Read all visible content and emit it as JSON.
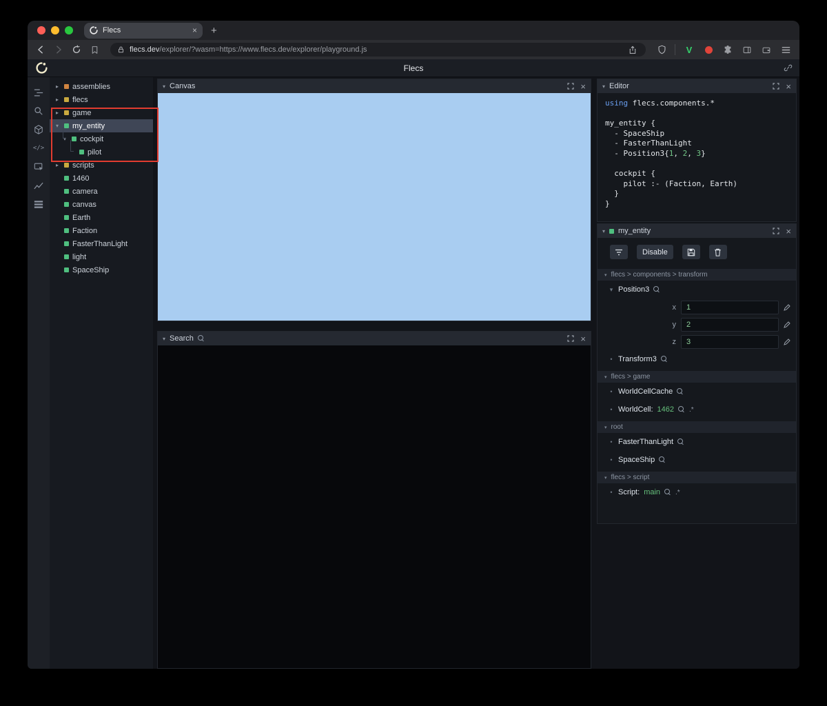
{
  "browser": {
    "tab_title": "Flecs",
    "url_domain": "flecs.dev",
    "url_rest": "/explorer/?wasm=https://www.flecs.dev/explorer/playground.js",
    "extension_v": "V"
  },
  "app": {
    "title": "Flecs",
    "canvas_color": "#a9cdf1",
    "annotation_color": "#e23c30",
    "tree": [
      {
        "label": "assemblies",
        "dot": "#d08440",
        "arrow": "collapsed",
        "indent": 0,
        "selected": false
      },
      {
        "label": "flecs",
        "dot": "#c9a93f",
        "arrow": "collapsed",
        "indent": 0,
        "selected": false
      },
      {
        "label": "game",
        "dot": "#c9a93f",
        "arrow": "collapsed",
        "indent": 0,
        "selected": false
      },
      {
        "label": "my_entity",
        "dot": "#4fbf7f",
        "arrow": "expanded",
        "indent": 0,
        "selected": true
      },
      {
        "label": "cockpit",
        "dot": "#4fbf7f",
        "arrow": "expanded",
        "indent": 1,
        "selected": false
      },
      {
        "label": "pilot",
        "dot": "#4fbf7f",
        "arrow": "none",
        "indent": 2,
        "selected": false
      },
      {
        "label": "scripts",
        "dot": "#c9a93f",
        "arrow": "collapsed",
        "indent": 0,
        "selected": false
      },
      {
        "label": "1460",
        "dot": "#4fbf7f",
        "arrow": "none",
        "indent": 0,
        "selected": false
      },
      {
        "label": "camera",
        "dot": "#4fbf7f",
        "arrow": "none",
        "indent": 0,
        "selected": false
      },
      {
        "label": "canvas",
        "dot": "#4fbf7f",
        "arrow": "none",
        "indent": 0,
        "selected": false
      },
      {
        "label": "Earth",
        "dot": "#4fbf7f",
        "arrow": "none",
        "indent": 0,
        "selected": false
      },
      {
        "label": "Faction",
        "dot": "#4fbf7f",
        "arrow": "none",
        "indent": 0,
        "selected": false
      },
      {
        "label": "FasterThanLight",
        "dot": "#4fbf7f",
        "arrow": "none",
        "indent": 0,
        "selected": false
      },
      {
        "label": "light",
        "dot": "#4fbf7f",
        "arrow": "none",
        "indent": 0,
        "selected": false
      },
      {
        "label": "SpaceShip",
        "dot": "#4fbf7f",
        "arrow": "none",
        "indent": 0,
        "selected": false
      }
    ],
    "panels": {
      "canvas": {
        "title": "Canvas"
      },
      "search": {
        "title": "Search"
      },
      "editor": {
        "title": "Editor"
      },
      "inspector": {
        "title": "my_entity",
        "disable_label": "Disable"
      }
    },
    "editor_lines": [
      [
        {
          "t": "using",
          "c": "kw"
        },
        {
          "t": " flecs.components.*"
        }
      ],
      [],
      [
        {
          "t": "my_entity {"
        }
      ],
      [
        {
          "t": "  - SpaceShip"
        }
      ],
      [
        {
          "t": "  - FasterThanLight"
        }
      ],
      [
        {
          "t": "  - Position3{"
        },
        {
          "t": "1",
          "c": "num"
        },
        {
          "t": ", "
        },
        {
          "t": "2",
          "c": "num"
        },
        {
          "t": ", "
        },
        {
          "t": "3",
          "c": "num"
        },
        {
          "t": "}"
        }
      ],
      [],
      [
        {
          "t": "  cockpit {"
        }
      ],
      [
        {
          "t": "    pilot :- (Faction, Earth)"
        }
      ],
      [
        {
          "t": "  }"
        }
      ],
      [
        {
          "t": "}"
        }
      ]
    ],
    "inspector_sections": [
      {
        "path": "flecs > components > transform",
        "items": [
          {
            "name": "Position3",
            "expanded": true,
            "fields": [
              {
                "label": "x",
                "value": "1"
              },
              {
                "label": "y",
                "value": "2"
              },
              {
                "label": "z",
                "value": "3"
              }
            ]
          },
          {
            "name": "Transform3"
          }
        ]
      },
      {
        "path": "flecs > game",
        "items": [
          {
            "name": "WorldCellCache"
          },
          {
            "name": "WorldCell:",
            "value": "1462",
            "suffix": ".*"
          }
        ]
      },
      {
        "path": "root",
        "items": [
          {
            "name": "FasterThanLight"
          },
          {
            "name": "SpaceShip"
          }
        ]
      },
      {
        "path": "flecs > script",
        "items": [
          {
            "name": "Script:",
            "value": "main",
            "suffix": ".*"
          }
        ]
      }
    ]
  }
}
